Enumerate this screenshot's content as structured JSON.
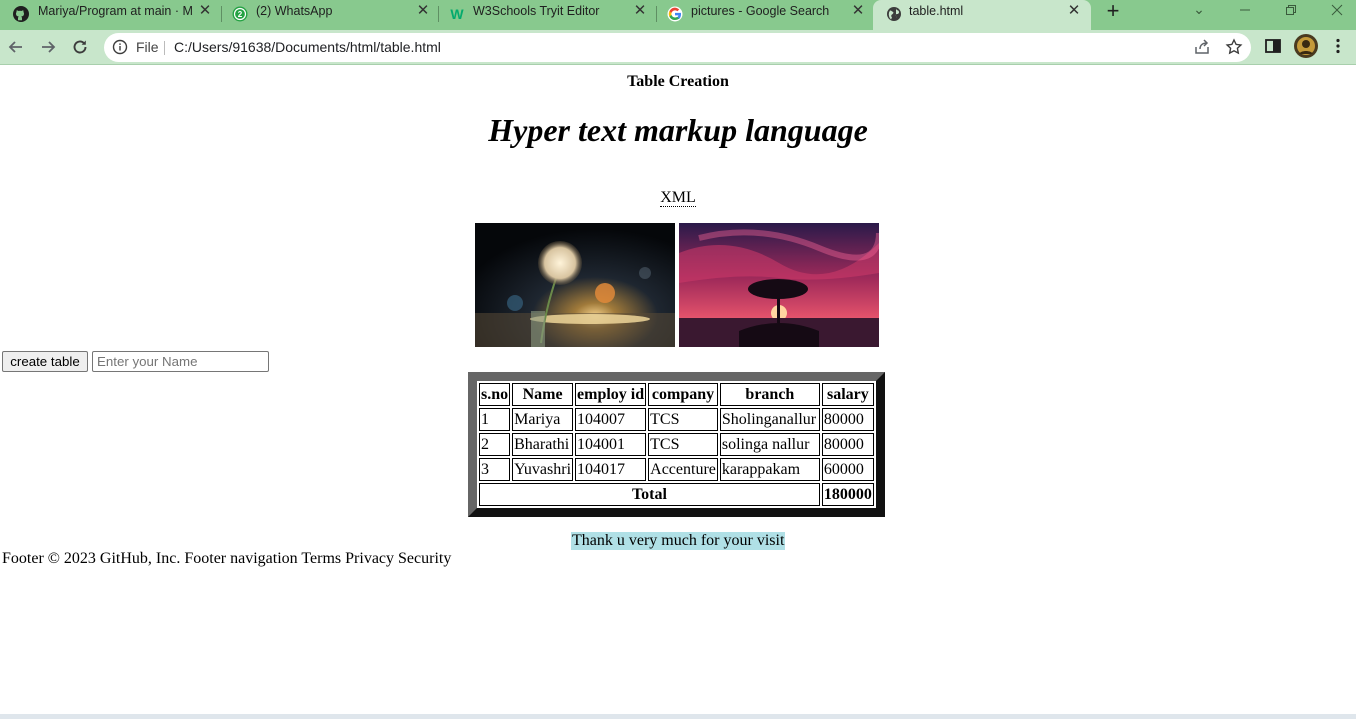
{
  "browser": {
    "tabs": [
      {
        "title": "Mariya/Program at main · Ma",
        "favicon": "github-icon",
        "active": false
      },
      {
        "title": "(2) WhatsApp",
        "favicon": "whatsapp-icon",
        "active": false
      },
      {
        "title": "W3Schools Tryit Editor",
        "favicon": "w3schools-icon",
        "active": false
      },
      {
        "title": "pictures - Google Search",
        "favicon": "google-icon",
        "active": false
      },
      {
        "title": "table.html",
        "favicon": "globe-icon",
        "active": true
      }
    ],
    "address": {
      "scheme_label": "File",
      "url": "C:/Users/91638/Documents/html/table.html"
    },
    "colors": {
      "tabstrip": "#88c98e",
      "toolbar": "#c8e6cb"
    }
  },
  "page": {
    "heading": "Table Creation",
    "title": "Hyper text markup language",
    "abbreviation": "XML",
    "images": [
      "dandelion-photo",
      "sunset-tree-photo"
    ],
    "create_button": "create table",
    "name_input": {
      "value": "",
      "placeholder": "Enter your Name"
    },
    "table": {
      "headers": [
        "s.no",
        "Name",
        "employ id",
        "company",
        "branch",
        "salary"
      ],
      "rows": [
        [
          "1",
          "Mariya",
          "104007",
          "TCS",
          "Sholinganallur",
          "80000"
        ],
        [
          "2",
          "Bharathi",
          "104001",
          "TCS",
          "solinga nallur",
          "80000"
        ],
        [
          "3",
          "Yuvashri",
          "104017",
          "Accenture",
          "karappakam",
          "60000"
        ]
      ],
      "total_label": "Total",
      "total_value": "180000"
    },
    "thanks": "Thank u very much for your visit",
    "footer": "Footer © 2023 GitHub, Inc. Footer navigation Terms Privacy Security"
  }
}
